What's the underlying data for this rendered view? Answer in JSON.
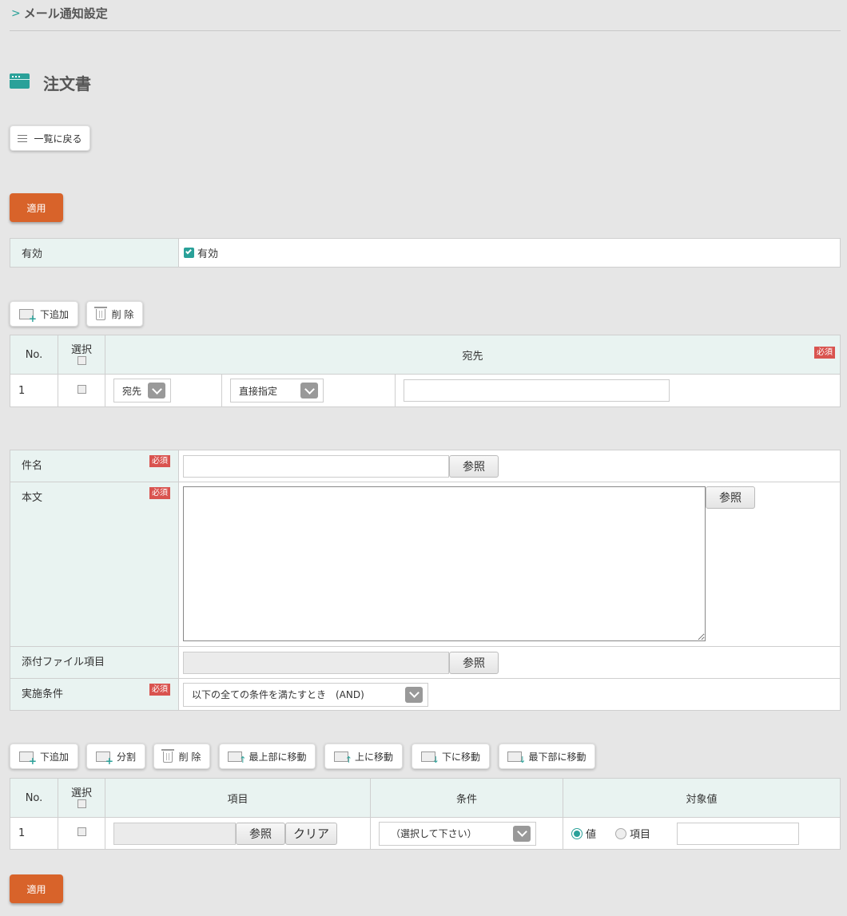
{
  "breadcrumb": {
    "label": "メール通知設定"
  },
  "page": {
    "title": "注文書"
  },
  "buttons": {
    "back_to_list": "一覧に戻る",
    "apply": "適用"
  },
  "enabled": {
    "label": "有効",
    "checkbox_label": "有効",
    "checked": true
  },
  "recipients": {
    "toolbar": {
      "add_below": "下追加",
      "delete": "削 除"
    },
    "headers": {
      "no": "No.",
      "select": "選択",
      "destination": "宛先"
    },
    "required_badge": "必須",
    "rows": [
      {
        "no": "1",
        "type": "宛先",
        "method": "直接指定",
        "value": ""
      }
    ]
  },
  "mail": {
    "subject_label": "件名",
    "body_label": "本文",
    "attachment_label": "添付ファイル項目",
    "condition_label": "実施条件",
    "required_badge": "必須",
    "ref_button": "参照",
    "condition_value": "以下の全ての条件を満たすとき　(AND)"
  },
  "conditions": {
    "toolbar": {
      "add_below": "下追加",
      "split": "分割",
      "delete": "削 除",
      "move_top": "最上部に移動",
      "move_up": "上に移動",
      "move_down": "下に移動",
      "move_bottom": "最下部に移動"
    },
    "headers": {
      "no": "No.",
      "select": "選択",
      "item": "項目",
      "condition": "条件",
      "target": "対象値"
    },
    "rows": [
      {
        "no": "1",
        "ref_button": "参照",
        "clear_button": "クリア",
        "condition": "（選択して下さい）",
        "radio_value": "値",
        "radio_item": "項目",
        "selected": "値"
      }
    ]
  },
  "colors": {
    "accent": "#2aa199",
    "apply": "#d8632a",
    "required": "#d9534f",
    "label_bg": "#e9f3f1"
  }
}
